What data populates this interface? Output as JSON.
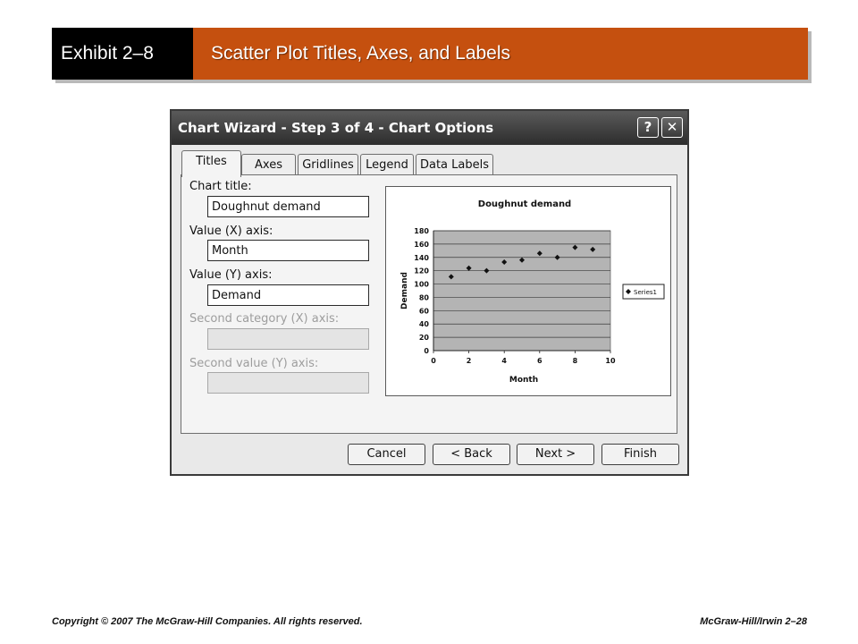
{
  "slide": {
    "exhibit": "Exhibit 2–8",
    "title": "Scatter Plot Titles, Axes, and Labels",
    "footer_left": "Copyright © 2007 The McGraw-Hill Companies. All rights reserved.",
    "footer_right": "McGraw-Hill/Irwin  2–28",
    "colors": {
      "banner_accent": "#c5500f",
      "banner_dark": "#000000"
    }
  },
  "dialog": {
    "title": "Chart Wizard - Step 3 of 4 - Chart Options",
    "help_label": "?",
    "close_label": "✕",
    "tabs": [
      {
        "label": "Titles",
        "active": true
      },
      {
        "label": "Axes"
      },
      {
        "label": "Gridlines"
      },
      {
        "label": "Legend"
      },
      {
        "label": "Data Labels"
      }
    ],
    "fields": {
      "chart_title": {
        "label": "Chart title:",
        "value": "Doughnut demand"
      },
      "x_axis": {
        "label": "Value (X) axis:",
        "value": "Month"
      },
      "y_axis": {
        "label": "Value (Y) axis:",
        "value": "Demand"
      },
      "second_x": {
        "label": "Second category (X) axis:",
        "value": ""
      },
      "second_y": {
        "label": "Second value (Y) axis:",
        "value": ""
      }
    },
    "buttons": {
      "cancel": "Cancel",
      "back": "< Back",
      "next": "Next >",
      "finish": "Finish"
    }
  },
  "chart_data": {
    "type": "scatter",
    "title": "Doughnut demand",
    "xlabel": "Month",
    "ylabel": "Demand",
    "xlim": [
      0,
      10
    ],
    "ylim": [
      0,
      180
    ],
    "xticks": [
      0,
      2,
      4,
      6,
      8,
      10
    ],
    "yticks": [
      0,
      20,
      40,
      60,
      80,
      100,
      120,
      140,
      160,
      180
    ],
    "grid": true,
    "legend": "right",
    "series": [
      {
        "name": "Series1",
        "x": [
          1,
          2,
          3,
          4,
          5,
          6,
          7,
          8,
          9
        ],
        "y": [
          111,
          124,
          120,
          133,
          136,
          146,
          140,
          155,
          152
        ]
      }
    ]
  }
}
